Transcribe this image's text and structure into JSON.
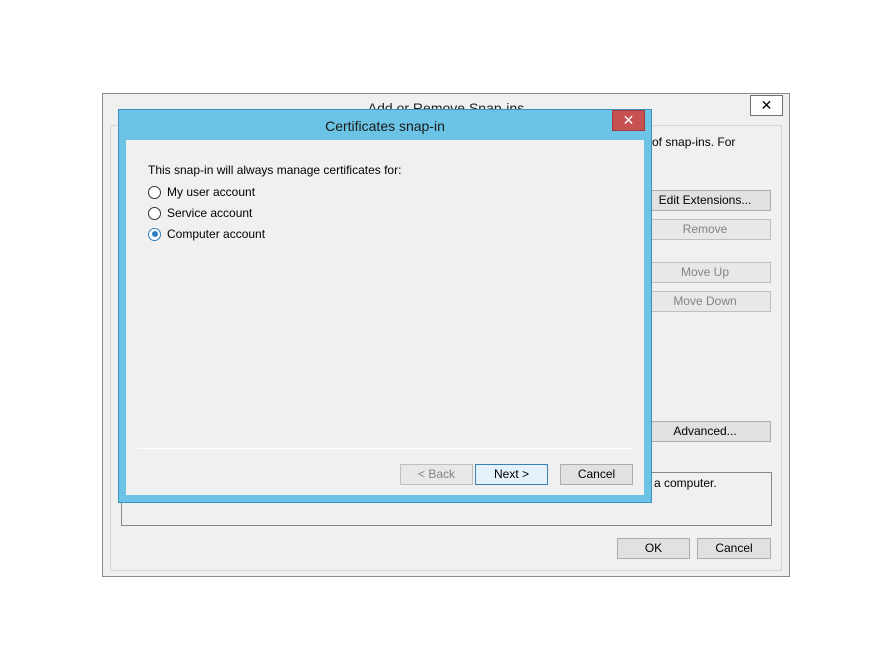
{
  "background_dialog": {
    "title": "Add or Remove Snap-ins",
    "close_glyph": "✕",
    "partial_text_top": "of snap-ins. For",
    "partial_text_desc": "a computer.",
    "buttons": {
      "edit_extensions": "Edit Extensions...",
      "remove": "Remove",
      "move_up": "Move Up",
      "move_down": "Move Down",
      "advanced": "Advanced...",
      "ok": "OK",
      "cancel": "Cancel"
    }
  },
  "certificates_dialog": {
    "title": "Certificates snap-in",
    "close_glyph": "✕",
    "prompt": "This snap-in will always manage certificates for:",
    "options": [
      {
        "label": "My user account",
        "checked": false
      },
      {
        "label": "Service account",
        "checked": false
      },
      {
        "label": "Computer account",
        "checked": true
      }
    ],
    "buttons": {
      "back": "< Back",
      "next": "Next >",
      "cancel": "Cancel"
    }
  }
}
